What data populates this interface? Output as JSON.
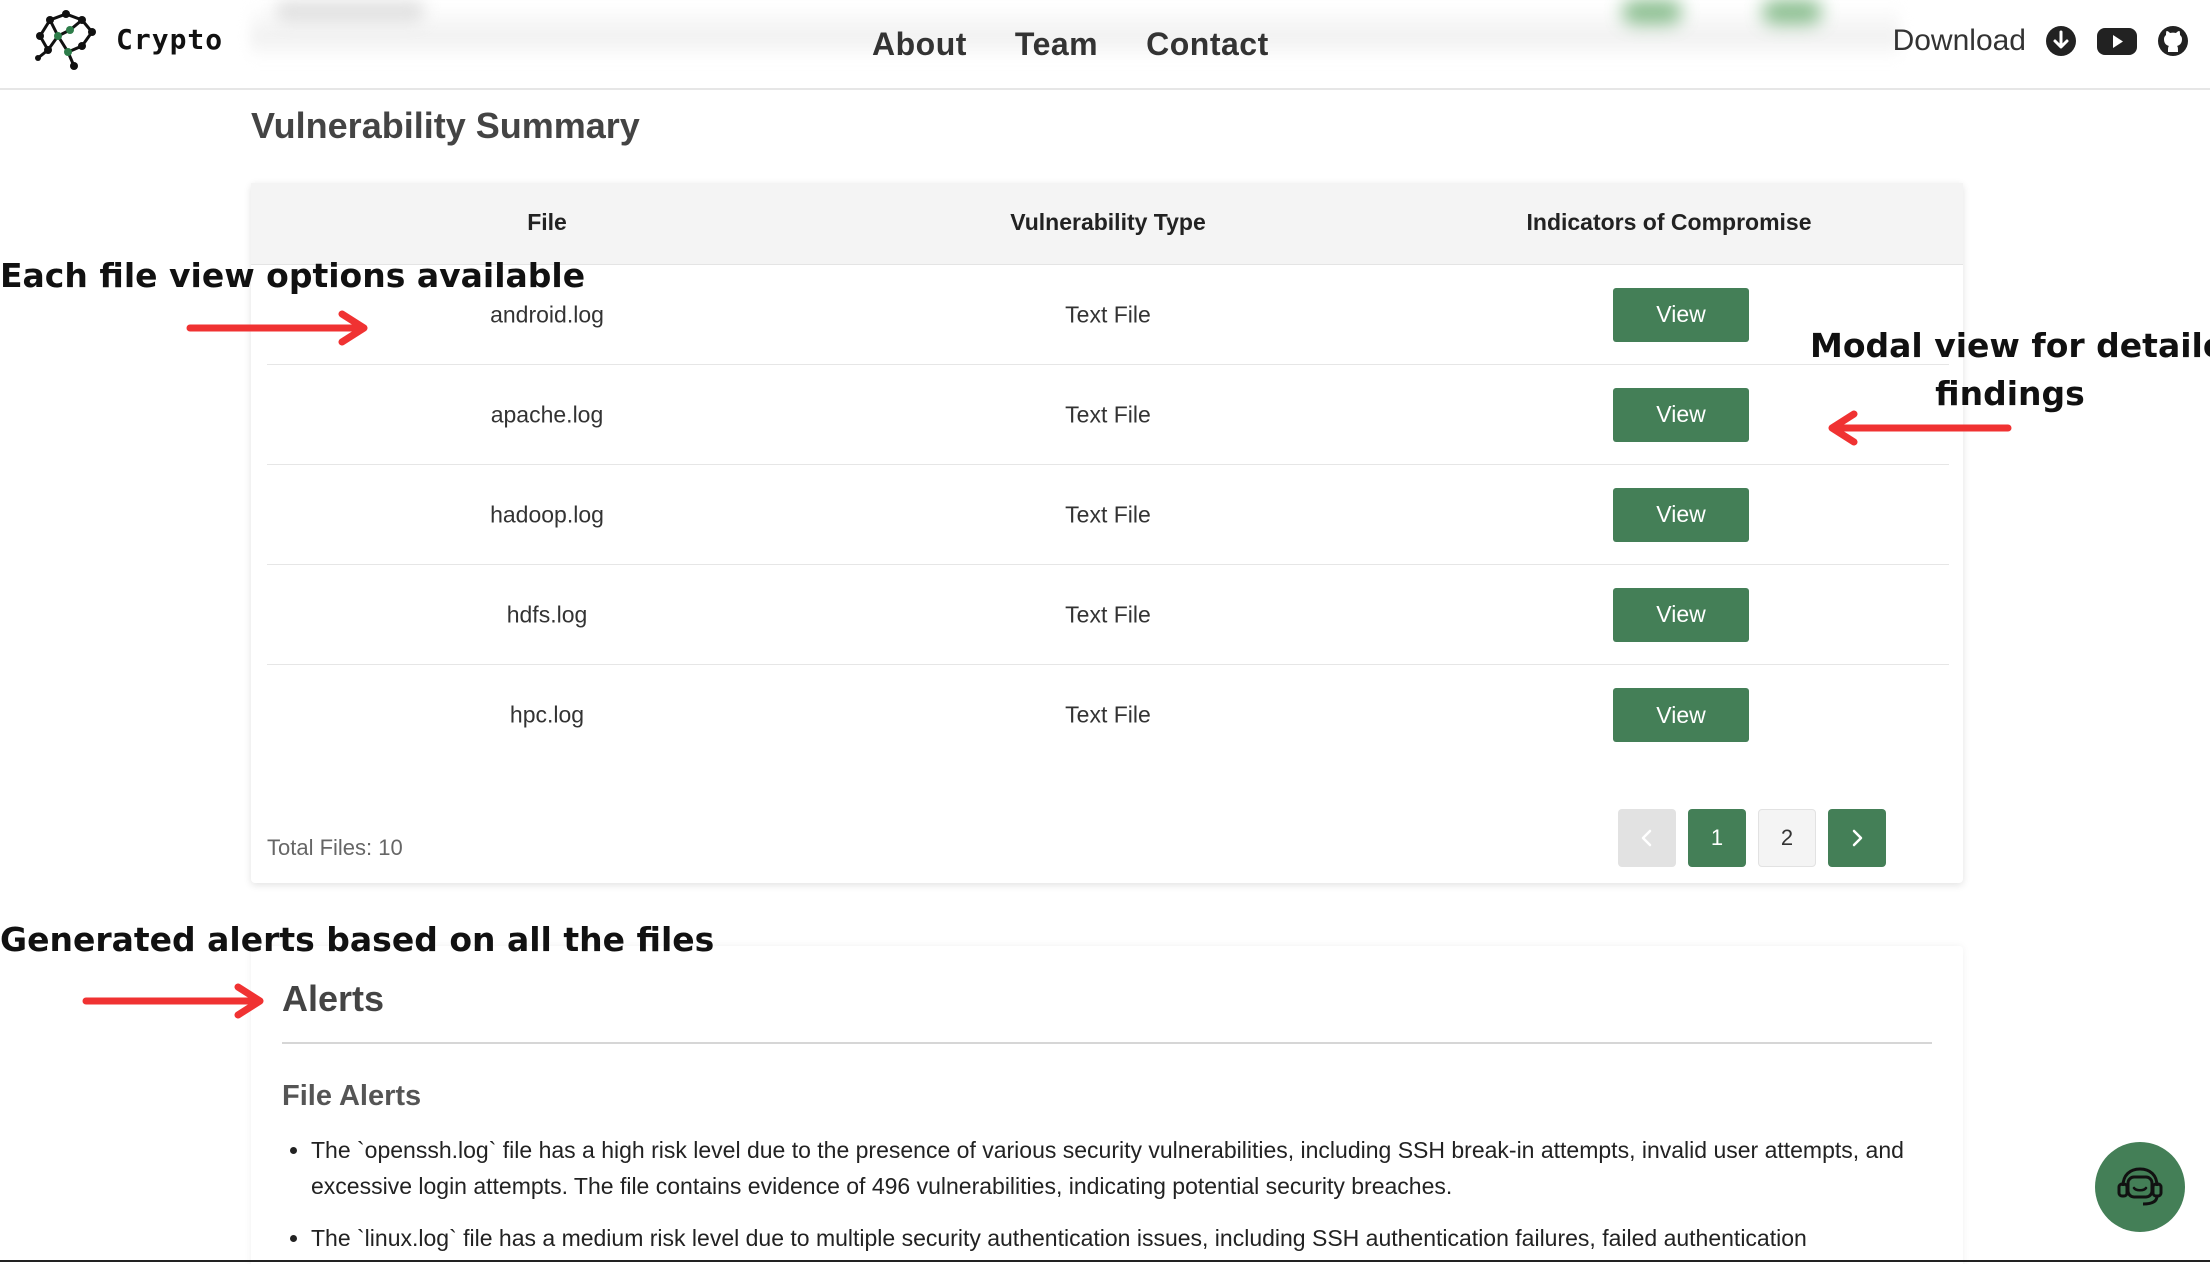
{
  "brand": {
    "name": "Crypto"
  },
  "nav": {
    "links": [
      "About",
      "Team",
      "Contact"
    ],
    "download_label": "Download"
  },
  "summary": {
    "title": "Vulnerability Summary",
    "columns": [
      "File",
      "Vulnerability Type",
      "Indicators of Compromise"
    ],
    "rows": [
      {
        "file": "android.log",
        "type": "Text File",
        "action": "View"
      },
      {
        "file": "apache.log",
        "type": "Text File",
        "action": "View"
      },
      {
        "file": "hadoop.log",
        "type": "Text File",
        "action": "View"
      },
      {
        "file": "hdfs.log",
        "type": "Text File",
        "action": "View"
      },
      {
        "file": "hpc.log",
        "type": "Text File",
        "action": "View"
      }
    ],
    "total_files": "Total Files: 10",
    "pagination": {
      "pages": [
        "1",
        "2"
      ],
      "current": "1"
    }
  },
  "alerts": {
    "title": "Alerts",
    "subtitle": "File Alerts",
    "items": [
      "The `openssh.log` file has a high risk level due to the presence of various security vulnerabilities, including SSH break-in attempts, invalid user attempts, and excessive login attempts. The file contains evidence of 496 vulnerabilities, indicating potential security breaches.",
      "The `linux.log` file has a medium risk level due to multiple security authentication issues, including SSH authentication failures, failed authentication"
    ]
  },
  "annotations": {
    "file_view": "Each file view options available",
    "modal_line1": "Modal view for detailed",
    "modal_line2": "findings",
    "alerts_note": "Generated alerts based on all the files"
  },
  "icons": {
    "download": "download-circle-icon",
    "youtube": "youtube-icon",
    "github": "github-icon",
    "chat": "chat-support-icon",
    "prev": "chevron-left-icon",
    "next": "chevron-right-icon"
  },
  "colors": {
    "accent": "#447f57",
    "annotation_arrow": "#f03232",
    "header_bg": "#f4f4f4"
  }
}
